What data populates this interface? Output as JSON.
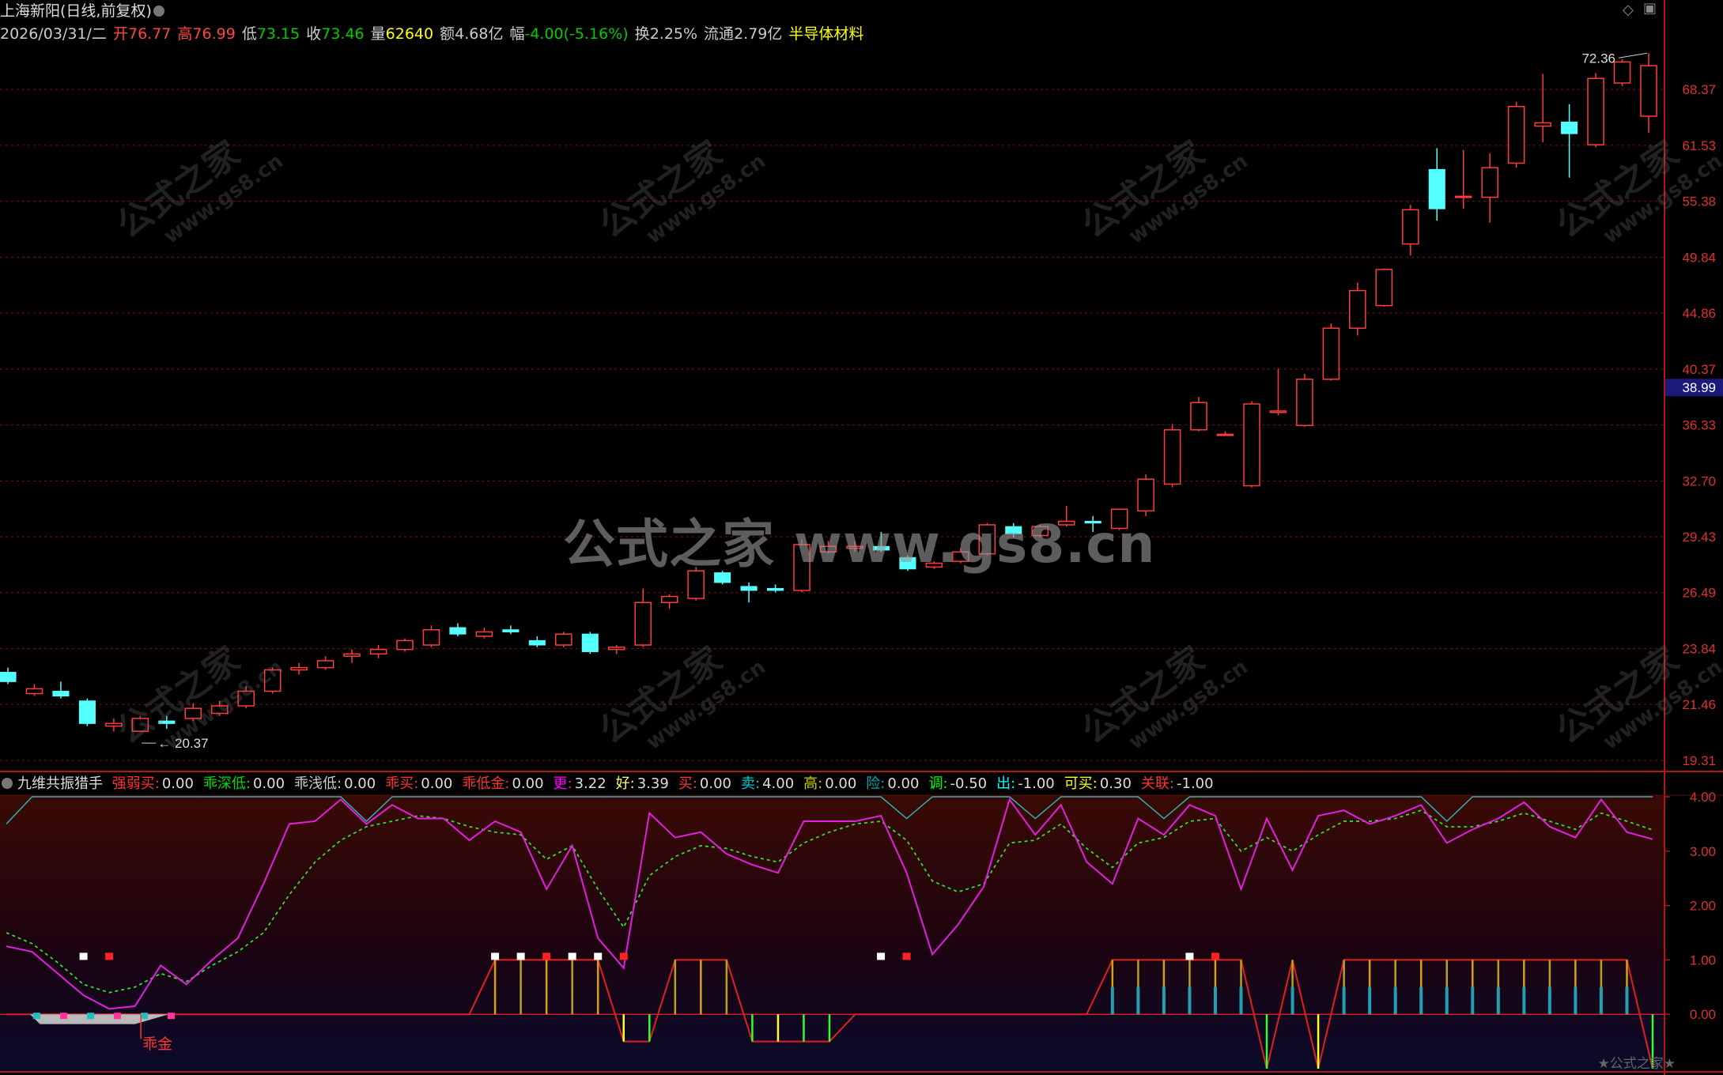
{
  "header": {
    "stock_name": "上海新阳",
    "period_label": "(日线,前复权)",
    "date": "2026/03/31/二",
    "quote": [
      {
        "label": "开",
        "value": "76.77",
        "color": "#ff4444",
        "label_color": "#ff4444"
      },
      {
        "label": "高",
        "value": "76.99",
        "color": "#ff4444",
        "label_color": "#ff4444"
      },
      {
        "label": "低",
        "value": "73.15",
        "color": "#00cc00",
        "label_color": "#cccccc"
      },
      {
        "label": "收",
        "value": "73.46",
        "color": "#00cc00",
        "label_color": "#cccccc"
      },
      {
        "label": "量",
        "value": "62640",
        "color": "#ffff00",
        "label_color": "#cccccc"
      },
      {
        "label": "额",
        "value": "4.68亿",
        "color": "#cccccc",
        "label_color": "#cccccc"
      },
      {
        "label": "幅",
        "value": "-4.00(-5.16%)",
        "color": "#00cc00",
        "label_color": "#cccccc"
      },
      {
        "label": "换",
        "value": "2.25%",
        "color": "#cccccc",
        "label_color": "#cccccc"
      },
      {
        "label": "流通",
        "value": "2.79亿",
        "color": "#cccccc",
        "label_color": "#cccccc"
      }
    ],
    "sector": "半导体材料",
    "sector_color": "#ffff00"
  },
  "price_axis": {
    "ticks": [
      "68.37",
      "61.53",
      "55.38",
      "49.84",
      "44.86",
      "40.37",
      "36.33",
      "32.70",
      "29.43",
      "26.49",
      "23.84",
      "21.46",
      "19.31"
    ],
    "current_price": "38.99",
    "high_marker": "72.36",
    "low_marker": "20.37"
  },
  "indicator": {
    "title": "九维共振猎手",
    "fields": [
      {
        "label": "强弱买:",
        "value": "0.00",
        "color": "#ff3333"
      },
      {
        "label": "乖深低:",
        "value": "0.00",
        "color": "#00dd00"
      },
      {
        "label": "乖浅低:",
        "value": "0.00",
        "color": "#cccccc"
      },
      {
        "label": "乖买:",
        "value": "0.00",
        "color": "#ff3333"
      },
      {
        "label": "乖低金:",
        "value": "0.00",
        "color": "#ff3333"
      },
      {
        "label": "更:",
        "value": "3.22",
        "color": "#ff00ff"
      },
      {
        "label": "好:",
        "value": "3.39",
        "color": "#ffff66"
      },
      {
        "label": "买:",
        "value": "0.00",
        "color": "#ff3333"
      },
      {
        "label": "卖:",
        "value": "4.00",
        "color": "#00cccc"
      },
      {
        "label": "高:",
        "value": "0.00",
        "color": "#cccc00"
      },
      {
        "label": "险:",
        "value": "0.00",
        "color": "#00aaaa"
      },
      {
        "label": "调:",
        "value": "-0.50",
        "color": "#00ff00"
      },
      {
        "label": "出:",
        "value": "-1.00",
        "color": "#00ffff"
      },
      {
        "label": "可买:",
        "value": "0.30",
        "color": "#ffff00"
      },
      {
        "label": "关联:",
        "value": "-1.00",
        "color": "#ff3333"
      }
    ],
    "axis_ticks": [
      "4.00",
      "3.00",
      "2.00",
      "1.00",
      "0.00"
    ],
    "annotation": "乖金"
  },
  "watermark": {
    "center": "公式之家 www.gs8.cn",
    "tile_title": "公式之家",
    "tile_url": "www.gs8.cn",
    "footer": "★公式之家★"
  },
  "chart_data": {
    "type": "candlestick",
    "ohlc": [
      [
        22.8,
        23.0,
        22.3,
        22.4
      ],
      [
        21.9,
        22.3,
        21.8,
        22.1
      ],
      [
        22.0,
        22.4,
        21.7,
        21.8
      ],
      [
        21.6,
        21.7,
        20.6,
        20.7
      ],
      [
        20.6,
        20.9,
        20.4,
        20.7
      ],
      [
        20.4,
        21.0,
        20.37,
        20.9
      ],
      [
        20.8,
        21.0,
        20.5,
        20.7
      ],
      [
        20.9,
        21.5,
        20.8,
        21.3
      ],
      [
        21.1,
        21.6,
        21.0,
        21.4
      ],
      [
        21.4,
        22.2,
        21.3,
        22.0
      ],
      [
        22.0,
        23.0,
        21.9,
        22.9
      ],
      [
        22.9,
        23.2,
        22.7,
        23.0
      ],
      [
        23.0,
        23.5,
        22.9,
        23.3
      ],
      [
        23.5,
        23.8,
        23.2,
        23.6
      ],
      [
        23.6,
        24.0,
        23.4,
        23.8
      ],
      [
        23.8,
        24.3,
        23.7,
        24.2
      ],
      [
        24.0,
        24.9,
        23.9,
        24.7
      ],
      [
        24.8,
        25.0,
        24.4,
        24.5
      ],
      [
        24.4,
        24.8,
        24.3,
        24.6
      ],
      [
        24.7,
        24.9,
        24.5,
        24.6
      ],
      [
        24.2,
        24.4,
        23.9,
        24.0
      ],
      [
        24.0,
        24.6,
        23.9,
        24.5
      ],
      [
        24.5,
        24.6,
        23.6,
        23.7
      ],
      [
        23.8,
        24.0,
        23.6,
        23.9
      ],
      [
        24.0,
        26.7,
        23.9,
        26.0
      ],
      [
        26.0,
        26.4,
        25.7,
        26.3
      ],
      [
        26.2,
        27.8,
        26.1,
        27.6
      ],
      [
        27.5,
        27.6,
        26.9,
        27.0
      ],
      [
        26.8,
        27.0,
        26.0,
        26.6
      ],
      [
        26.7,
        26.9,
        26.5,
        26.6
      ],
      [
        26.6,
        29.3,
        26.5,
        29.0
      ],
      [
        28.6,
        29.2,
        28.5,
        28.9
      ],
      [
        28.8,
        29.2,
        28.6,
        28.9
      ],
      [
        28.9,
        29.7,
        28.6,
        28.7
      ],
      [
        28.3,
        28.4,
        27.6,
        27.7
      ],
      [
        27.8,
        28.1,
        27.7,
        28.0
      ],
      [
        28.1,
        28.8,
        28.0,
        28.6
      ],
      [
        28.5,
        30.2,
        28.4,
        30.1
      ],
      [
        30.0,
        30.2,
        29.4,
        29.6
      ],
      [
        29.5,
        30.1,
        29.4,
        30.0
      ],
      [
        30.1,
        31.2,
        30.0,
        30.3
      ],
      [
        30.3,
        30.6,
        29.7,
        30.2
      ],
      [
        29.9,
        30.9,
        29.8,
        31.0
      ],
      [
        30.9,
        33.1,
        30.6,
        32.8
      ],
      [
        32.5,
        36.4,
        32.3,
        36.0
      ],
      [
        36.0,
        38.3,
        35.9,
        37.9
      ],
      [
        35.7,
        35.9,
        35.6,
        35.7
      ],
      [
        32.4,
        38.0,
        32.3,
        37.8
      ],
      [
        37.2,
        40.4,
        37.0,
        37.3
      ],
      [
        36.3,
        40.0,
        36.2,
        39.6
      ],
      [
        39.6,
        44.0,
        39.5,
        43.6
      ],
      [
        43.6,
        47.5,
        43.0,
        46.8
      ],
      [
        45.5,
        48.8,
        45.4,
        48.7
      ],
      [
        51.1,
        55.0,
        50.0,
        54.5
      ],
      [
        58.8,
        61.2,
        53.4,
        54.6
      ],
      [
        55.8,
        61.0,
        54.6,
        55.9
      ],
      [
        55.8,
        60.6,
        53.2,
        59.0
      ],
      [
        59.5,
        66.8,
        59.0,
        66.2
      ],
      [
        63.8,
        70.4,
        61.9,
        64.2
      ],
      [
        64.3,
        66.5,
        57.9,
        62.9
      ],
      [
        61.6,
        70.5,
        61.3,
        69.8
      ],
      [
        69.2,
        72.36,
        68.8,
        72.0
      ],
      [
        65.0,
        73.2,
        63.0,
        71.5
      ]
    ],
    "y_scale": "log",
    "ylim": [
      19.31,
      74.0
    ],
    "osc": {
      "ylim": [
        -1.0,
        4.0
      ],
      "magenta": [
        1.25,
        1.15,
        0.75,
        0.35,
        0.1,
        0.15,
        0.9,
        0.55,
        1.0,
        1.4,
        2.4,
        3.5,
        3.55,
        3.95,
        3.5,
        3.85,
        3.6,
        3.6,
        3.2,
        3.55,
        3.35,
        2.3,
        3.1,
        1.4,
        0.85,
        3.7,
        3.25,
        3.35,
        2.95,
        2.75,
        2.6,
        3.55,
        3.55,
        3.55,
        3.65,
        2.6,
        1.1,
        1.65,
        2.35,
        3.95,
        3.3,
        3.85,
        2.8,
        2.4,
        3.6,
        3.3,
        3.85,
        3.65,
        2.3,
        3.6,
        2.65,
        3.65,
        3.75,
        3.5,
        3.65,
        3.85,
        3.15,
        3.4,
        3.6,
        3.9,
        3.45,
        3.25,
        3.95,
        3.35,
        3.22
      ],
      "green": [
        1.5,
        1.3,
        0.95,
        0.55,
        0.4,
        0.5,
        0.75,
        0.6,
        0.9,
        1.15,
        1.5,
        2.2,
        2.8,
        3.2,
        3.45,
        3.55,
        3.65,
        3.6,
        3.45,
        3.35,
        3.3,
        2.85,
        3.1,
        2.3,
        1.6,
        2.55,
        2.9,
        3.1,
        3.05,
        2.9,
        2.8,
        3.15,
        3.35,
        3.5,
        3.55,
        3.2,
        2.45,
        2.25,
        2.4,
        3.15,
        3.2,
        3.5,
        3.05,
        2.7,
        3.15,
        3.25,
        3.55,
        3.6,
        3.0,
        3.25,
        3.0,
        3.3,
        3.55,
        3.55,
        3.6,
        3.75,
        3.45,
        3.45,
        3.55,
        3.7,
        3.55,
        3.4,
        3.7,
        3.55,
        3.39
      ],
      "cyan": [
        3.5,
        4.0,
        4.0,
        4.0,
        4.0,
        4.0,
        4.0,
        4.0,
        4.0,
        4.0,
        4.0,
        4.0,
        4.0,
        4.0,
        3.55,
        4.0,
        4.0,
        4.0,
        4.0,
        4.0,
        4.0,
        4.0,
        4.0,
        4.0,
        4.0,
        4.0,
        4.0,
        4.0,
        4.0,
        4.0,
        4.0,
        4.0,
        4.0,
        4.0,
        4.0,
        3.6,
        4.0,
        4.0,
        4.0,
        4.0,
        3.6,
        4.0,
        4.0,
        4.0,
        4.0,
        3.6,
        4.0,
        4.0,
        4.0,
        4.0,
        4.0,
        4.0,
        4.0,
        4.0,
        4.0,
        4.0,
        3.55,
        4.0,
        4.0,
        4.0,
        4.0,
        4.0,
        4.0,
        4.0,
        4.0
      ],
      "step": [
        0,
        0,
        0,
        0,
        0,
        0,
        0,
        0,
        0,
        0,
        0,
        0,
        0,
        0,
        0,
        0,
        0,
        0,
        0,
        1,
        1,
        1,
        1,
        1,
        -0.5,
        -0.5,
        1,
        1,
        1,
        -0.5,
        -0.5,
        -0.5,
        -0.5,
        0,
        0,
        0,
        0,
        0,
        0,
        0,
        0,
        0,
        0,
        1,
        1,
        1,
        1,
        1,
        1,
        -1,
        1,
        -1,
        1,
        1,
        1,
        1,
        1,
        1,
        1,
        1,
        1,
        1,
        1,
        1,
        -1
      ]
    }
  }
}
